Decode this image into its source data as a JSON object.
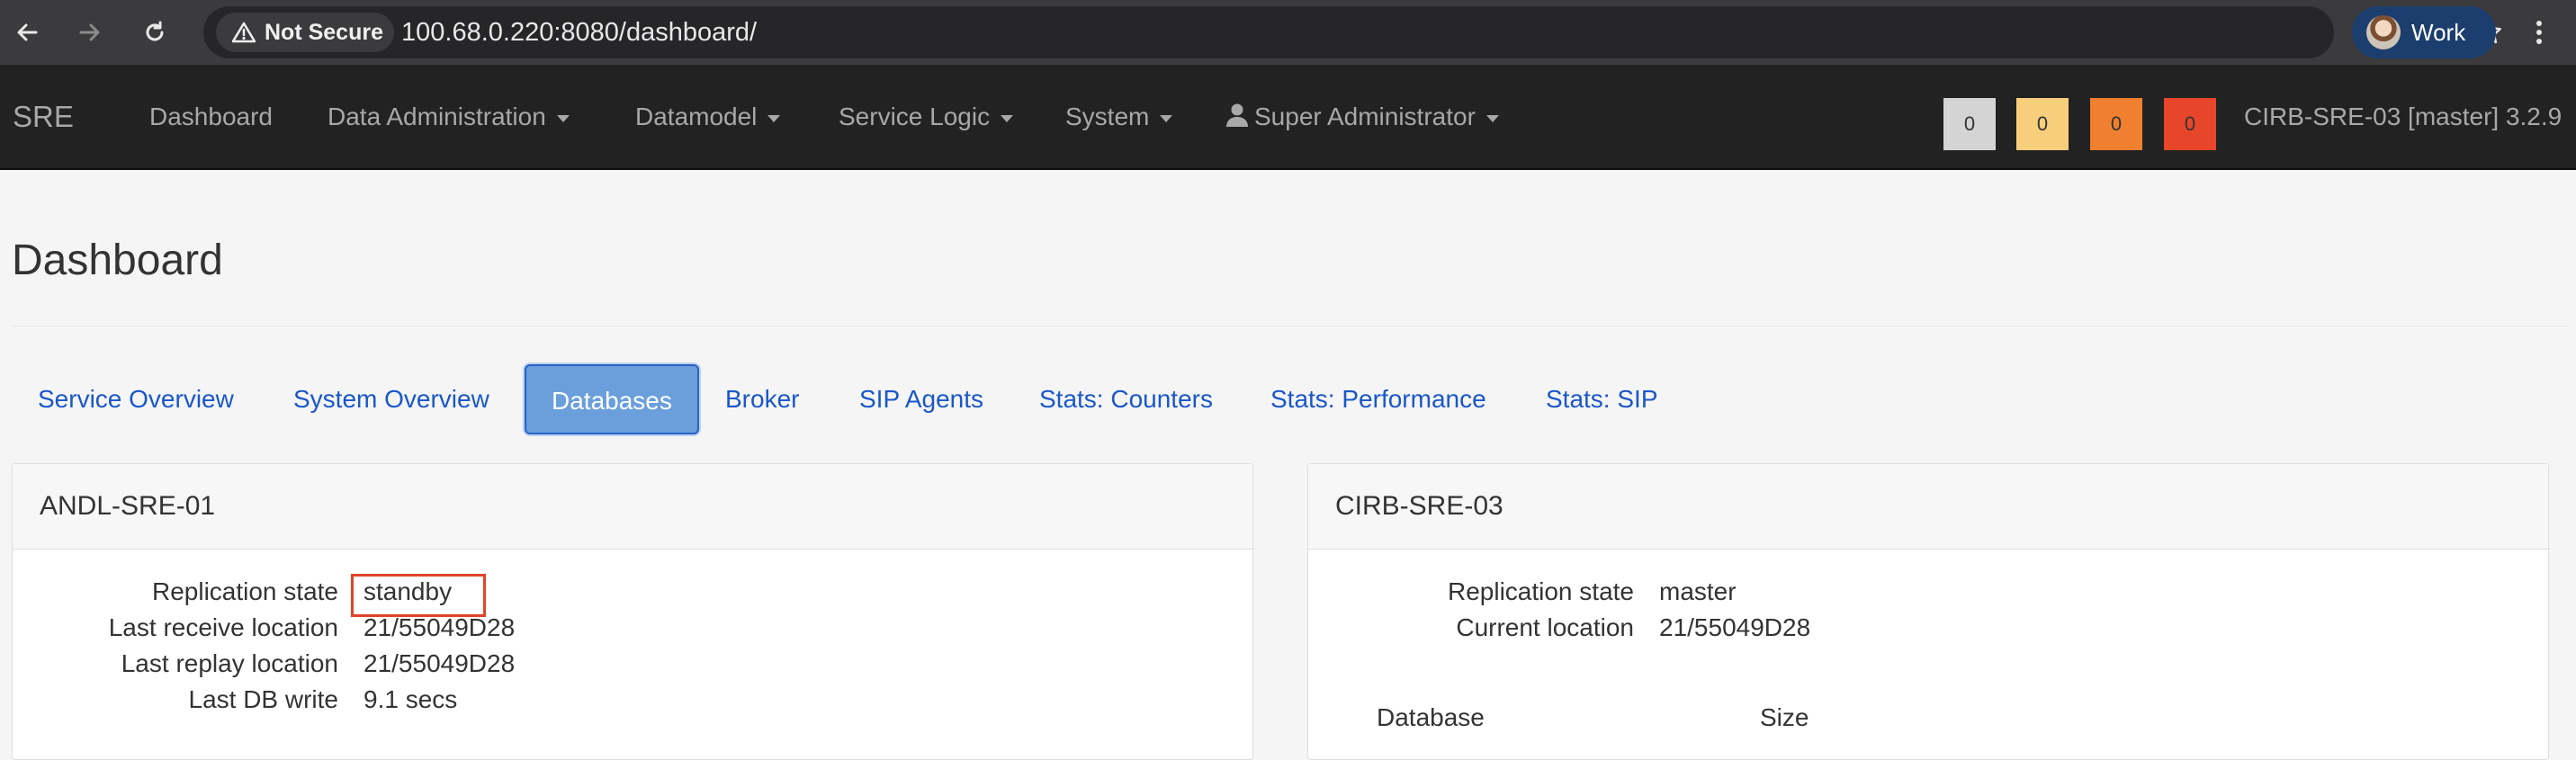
{
  "browser": {
    "security_label": "Not Secure",
    "url": "100.68.0.220:8080/dashboard/",
    "profile_label": "Work"
  },
  "navbar": {
    "brand": "SRE",
    "items": [
      {
        "label": "Dashboard"
      },
      {
        "label": "Data Administration"
      },
      {
        "label": "Datamodel"
      },
      {
        "label": "Service Logic"
      },
      {
        "label": "System"
      }
    ],
    "user_label": "Super Administrator",
    "badges": [
      {
        "value": "0",
        "color": "#d4d4d4"
      },
      {
        "value": "0",
        "color": "#f7cf7c"
      },
      {
        "value": "0",
        "color": "#f0802f"
      },
      {
        "value": "0",
        "color": "#e8462b"
      }
    ],
    "instance_label": "CIRB-SRE-03 [master] 3.2.9"
  },
  "page": {
    "title": "Dashboard",
    "tabs": [
      {
        "label": "Service Overview"
      },
      {
        "label": "System Overview"
      },
      {
        "label": "Databases",
        "active": true
      },
      {
        "label": "Broker"
      },
      {
        "label": "SIP Agents"
      },
      {
        "label": "Stats: Counters"
      },
      {
        "label": "Stats: Performance"
      },
      {
        "label": "Stats: SIP"
      }
    ]
  },
  "panels": {
    "left": {
      "title": "ANDL-SRE-01",
      "rows": [
        {
          "label": "Replication state",
          "value": "standby"
        },
        {
          "label": "Last receive location",
          "value": "21/55049D28"
        },
        {
          "label": "Last replay location",
          "value": "21/55049D28"
        },
        {
          "label": "Last DB write",
          "value": "9.1 secs"
        }
      ]
    },
    "right": {
      "title": "CIRB-SRE-03",
      "rows": [
        {
          "label": "Replication state",
          "value": "master"
        },
        {
          "label": "Current location",
          "value": "21/55049D28"
        }
      ],
      "table_headers": [
        "Database",
        "Size"
      ]
    }
  },
  "colors": {
    "accent_link": "#1a57c9",
    "active_tab": "#6a9fdc",
    "highlight_outline": "#e0442a"
  }
}
